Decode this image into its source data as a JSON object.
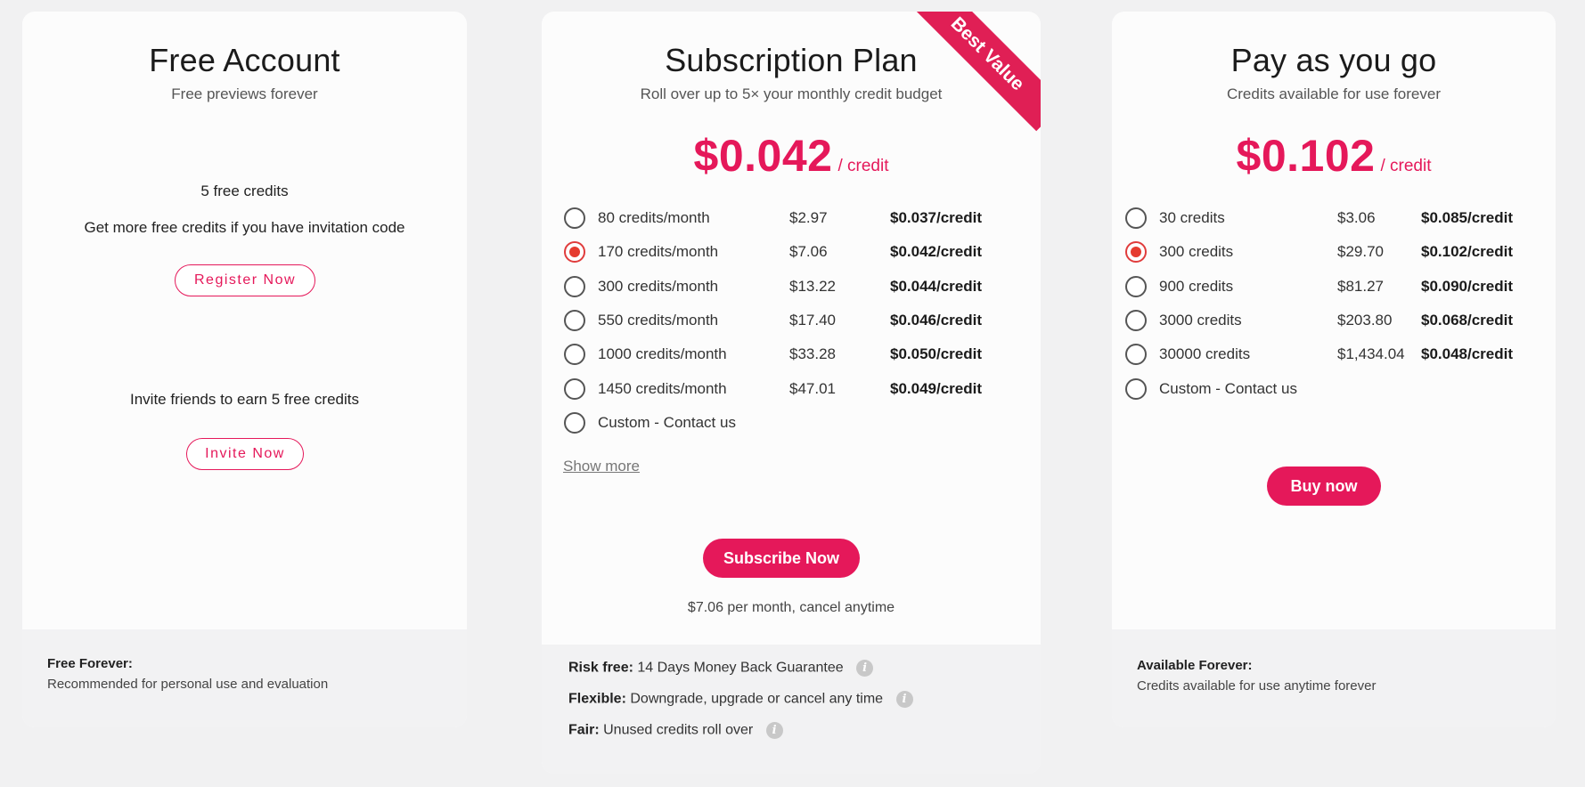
{
  "free": {
    "title": "Free Account",
    "subtitle": "Free previews forever",
    "credits_line": "5 free credits",
    "invite_code_line": "Get more free credits if you have invitation code",
    "register_label": "Register Now",
    "invite_friends_line": "Invite friends to earn 5 free credits",
    "invite_label": "Invite Now",
    "footer_bold": "Free Forever:",
    "footer_text": "Recommended for personal use and evaluation"
  },
  "subscription": {
    "title": "Subscription Plan",
    "subtitle": "Roll over up to 5× your monthly credit budget",
    "ribbon": "Best Value",
    "price": "$0.042",
    "price_unit": "/ credit",
    "options": [
      {
        "label": "80 credits/month",
        "price": "$2.97",
        "per": "$0.037/credit",
        "selected": false
      },
      {
        "label": "170 credits/month",
        "price": "$7.06",
        "per": "$0.042/credit",
        "selected": true
      },
      {
        "label": "300 credits/month",
        "price": "$13.22",
        "per": "$0.044/credit",
        "selected": false
      },
      {
        "label": "550 credits/month",
        "price": "$17.40",
        "per": "$0.046/credit",
        "selected": false
      },
      {
        "label": "1000 credits/month",
        "price": "$33.28",
        "per": "$0.050/credit",
        "selected": false
      },
      {
        "label": "1450 credits/month",
        "price": "$47.01",
        "per": "$0.049/credit",
        "selected": false
      },
      {
        "label": "Custom - Contact us",
        "price": "",
        "per": "",
        "selected": false
      }
    ],
    "show_more": "Show more",
    "button_label": "Subscribe Now",
    "note": "$7.06 per month, cancel anytime",
    "features": [
      {
        "bold": "Risk free:",
        "text": "14 Days Money Back Guarantee"
      },
      {
        "bold": "Flexible:",
        "text": "Downgrade, upgrade or cancel any time"
      },
      {
        "bold": "Fair:",
        "text": "Unused credits roll over"
      }
    ]
  },
  "payg": {
    "title": "Pay as you go",
    "subtitle": "Credits available for use forever",
    "price": "$0.102",
    "price_unit": "/ credit",
    "options": [
      {
        "label": "30 credits",
        "price": "$3.06",
        "per": "$0.085/credit",
        "selected": false
      },
      {
        "label": "300 credits",
        "price": "$29.70",
        "per": "$0.102/credit",
        "selected": true
      },
      {
        "label": "900 credits",
        "price": "$81.27",
        "per": "$0.090/credit",
        "selected": false
      },
      {
        "label": "3000 credits",
        "price": "$203.80",
        "per": "$0.068/credit",
        "selected": false
      },
      {
        "label": "30000 credits",
        "price": "$1,434.04",
        "per": "$0.048/credit",
        "selected": false
      },
      {
        "label": "Custom - Contact us",
        "price": "",
        "per": "",
        "selected": false
      }
    ],
    "button_label": "Buy now",
    "footer_bold": "Available Forever:",
    "footer_text": "Credits available for use anytime forever"
  },
  "colors": {
    "accent": "#e5185a",
    "radio_selected": "#e53b2f",
    "page_bg": "#f1f1f2",
    "card_bg": "#fcfcfc"
  }
}
